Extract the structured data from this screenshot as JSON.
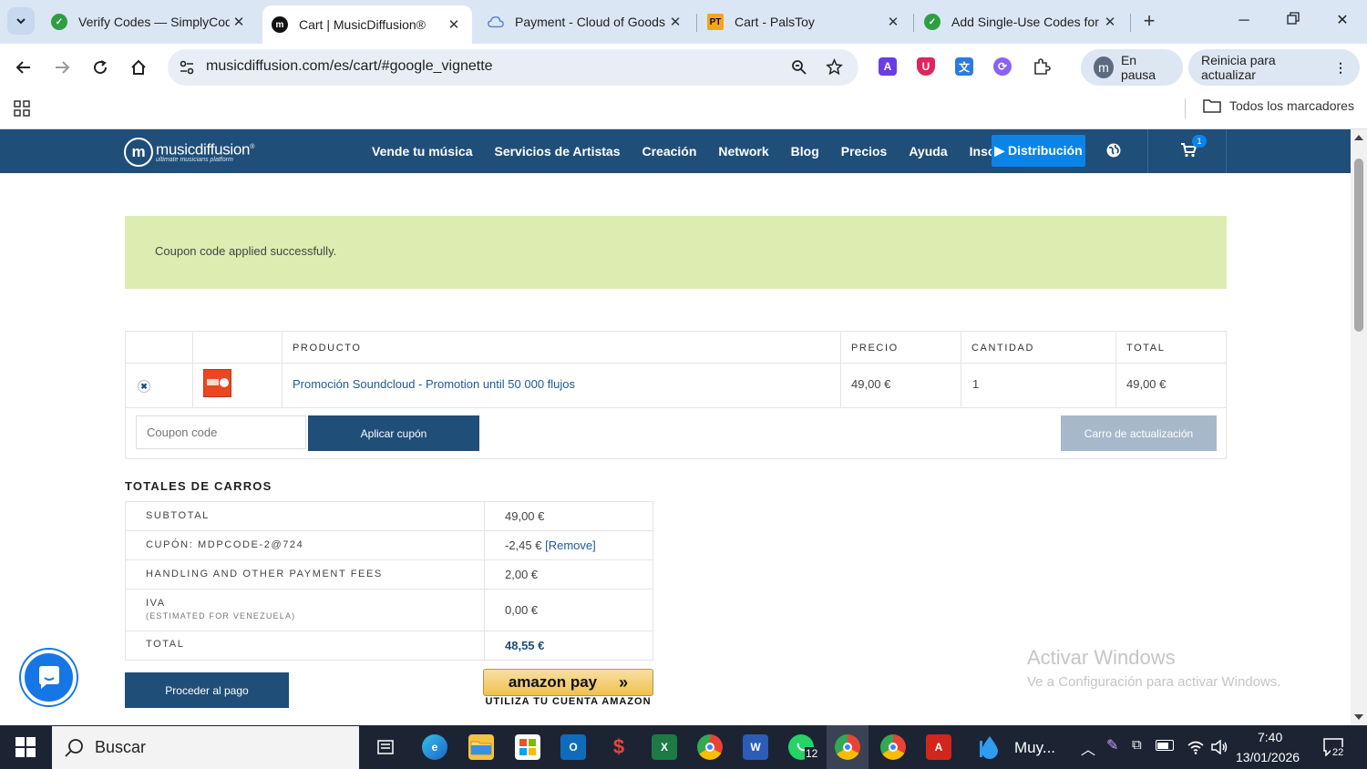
{
  "browser": {
    "tabs": [
      {
        "title": "Verify Codes — SimplyCodes",
        "favicon": "simplycodes-icon",
        "color": "#2e9e42"
      },
      {
        "title": "Cart | MusicDiffusion®",
        "favicon": "musicdiffusion-icon",
        "color": "#111111"
      },
      {
        "title": "Payment - Cloud of Goods",
        "favicon": "cloud-icon",
        "color": "#5a86c7"
      },
      {
        "title": "Cart - PalsToy",
        "favicon": "palstoy-icon",
        "color": "#f4a51c"
      },
      {
        "title": "Add Single-Use Codes for",
        "favicon": "simplycodes-icon",
        "color": "#2e9e42"
      }
    ],
    "active_tab_index": 1,
    "url": "musicdiffusion.com/es/cart/#google_vignette",
    "profile_label": "En pausa",
    "profile_initial": "m",
    "update_label": "Reinicia para actualizar",
    "bookmarks_label": "Todos los marcadores"
  },
  "site": {
    "logo_text": "musicdiffusion",
    "logo_registered": "®",
    "logo_tagline": "ultimate musicians platform",
    "nav": [
      "Vende tu música",
      "Servicios de Artistas",
      "Creación",
      "Network",
      "Blog",
      "Precios",
      "Ayuda",
      "Inscribirse"
    ],
    "distribution_button": "▶ Distribución",
    "cart_count": "1",
    "accent": "#1f4e79",
    "bright_blue": "#0b84e8"
  },
  "notice": {
    "text": "Coupon code applied successfully.",
    "color": "#ddecb0"
  },
  "cart": {
    "headers": {
      "product": "PRODUCTO",
      "price": "PRECIO",
      "quantity": "CANTIDAD",
      "total": "TOTAL"
    },
    "items": [
      {
        "product": "Promoción Soundcloud - Promotion until 50 000 flujos",
        "price": "49,00 €",
        "quantity": "1",
        "total": "49,00 €"
      }
    ],
    "coupon_placeholder": "Coupon code",
    "apply_coupon_label": "Aplicar cupón",
    "update_cart_label": "Carro de actualización"
  },
  "totals": {
    "title": "TOTALES DE CARROS",
    "rows": [
      {
        "label": "SUBTOTAL",
        "value": "49,00 €"
      },
      {
        "label": "CUPÓN: MDPCODE-2@724",
        "value": "-2,45 €",
        "link": "[Remove]"
      },
      {
        "label": "HANDLING AND OTHER PAYMENT FEES",
        "value": "2,00 €"
      },
      {
        "label": "IVA",
        "sublabel": "(ESTIMATED FOR VENEZUELA)",
        "value": "0,00 €"
      },
      {
        "label": "TOTAL",
        "value": "48,55 €"
      }
    ],
    "checkout_label": "Proceder al pago",
    "amazon_label": "amazon pay",
    "amazon_sub": "UTILIZA TU CUENTA AMAZON"
  },
  "watermark": {
    "line1": "Activar Windows",
    "line2": "Ve a Configuración para activar Windows."
  },
  "taskbar": {
    "search_label": "Buscar",
    "weather_label": "Muy...",
    "whatsapp_badge": "12",
    "time": "7:40",
    "date": "13/01/2026",
    "notifications": "22"
  }
}
